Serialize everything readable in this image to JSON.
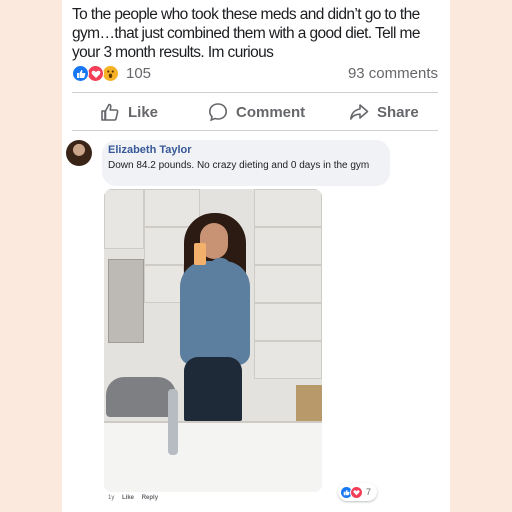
{
  "post": {
    "text": "To the people who took these meds and didn’t go to the gym…that just combined them with a good diet. Tell me your 3 month results. Im curious",
    "reaction_icons": [
      "like-icon",
      "love-icon",
      "wow-icon"
    ],
    "reaction_count": "105",
    "comments_count": "93 comments"
  },
  "actions": {
    "like_label": "Like",
    "comment_label": "Comment",
    "share_label": "Share"
  },
  "comment": {
    "author": "Elizabeth Taylor",
    "text": "Down 84.2 pounds. No crazy dieting and 0 days in the gym",
    "photo_icon": "mirror-selfie-photo",
    "time": "1y",
    "like_label": "Like",
    "reply_label": "Reply",
    "reaction_count": "7",
    "reaction_icons": [
      "like-icon",
      "love-icon"
    ]
  },
  "colors": {
    "background": "#fbe9dd",
    "like_blue": "#1877f2",
    "love_red": "#f33e58",
    "wow_yellow": "#f7b125",
    "name_blue": "#385898"
  }
}
